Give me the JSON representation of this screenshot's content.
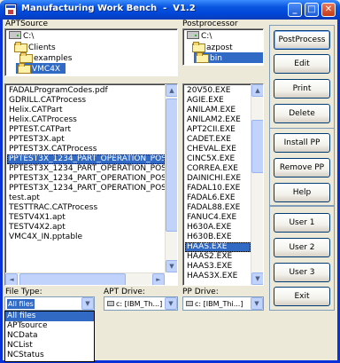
{
  "window": {
    "title": "Manufacturing Work Bench  -  V1.2",
    "minimize": "_",
    "maximize": "□",
    "close": "✕"
  },
  "apt_source": {
    "label": "APTSource",
    "tree": [
      "C:\\",
      "Clients",
      "examples",
      "VMC4X"
    ],
    "selected": "VMC4X"
  },
  "postprocessor": {
    "label": "Postprocessor",
    "tree": [
      "C:\\",
      "azpost",
      "bin"
    ],
    "selected": "bin"
  },
  "files": [
    "FADALProgramCodes.pdf",
    "GDRILL.CATProcess",
    "Helix.CATPart",
    "Helix.CATProcess",
    "PPTEST.CATPart",
    "PPTEST3X.apt",
    "PPTEST3X.CATProcess",
    "PPTEST3X_1234_PART_OPERATION_POSTPRO",
    "PPTEST3X_1234_PART_OPERATION_POSTPRO",
    "PPTEST3X_1234_PART_OPERATION_POSTPRO",
    "PPTEST3X_1234_PART_OPERATION_POSTPRO",
    "test.apt",
    "TESTTRAC.CATProcess",
    "TESTV4X1.apt",
    "TESTV4X2.apt",
    "VMC4X_IN.pptable"
  ],
  "files_selected_index": 7,
  "posts": [
    "20V50.EXE",
    "AGIE.EXE",
    "ANILAM.EXE",
    "ANILAM2.EXE",
    "APT2CII.EXE",
    "CADET.EXE",
    "CHEVAL.EXE",
    "CINC5X.EXE",
    "CORREA.EXE",
    "DAINICHI.EXE",
    "FADAL10.EXE",
    "FADAL6.EXE",
    "FADAL88.EXE",
    "FANUC4.EXE",
    "H630A.EXE",
    "H630B.EXE",
    "HAAS.EXE",
    "HAAS2.EXE",
    "HAAS3.EXE",
    "HAAS3X.EXE"
  ],
  "posts_selected_index": 16,
  "buttons": {
    "postprocess": "PostProcess",
    "edit": "Edit",
    "print": "Print",
    "delete": "Delete",
    "install_pp": "Install PP",
    "remove_pp": "Remove PP",
    "help": "Help",
    "user1": "User 1",
    "user2": "User 2",
    "user3": "User 3",
    "exit": "Exit"
  },
  "file_type": {
    "label": "File Type:",
    "value": "All files",
    "options": [
      "All files",
      "APTsource",
      "NCData",
      "NCList",
      "NCStatus"
    ],
    "selected_index": 0
  },
  "apt_drive": {
    "label": "APT Drive:",
    "value": "c: [IBM_Th...]"
  },
  "pp_drive": {
    "label": "PP Drive:",
    "value": "c: [IBM_Thi...]"
  },
  "scroll_arrows": {
    "up": "▲",
    "down": "▼",
    "left": "◄",
    "right": "►"
  }
}
